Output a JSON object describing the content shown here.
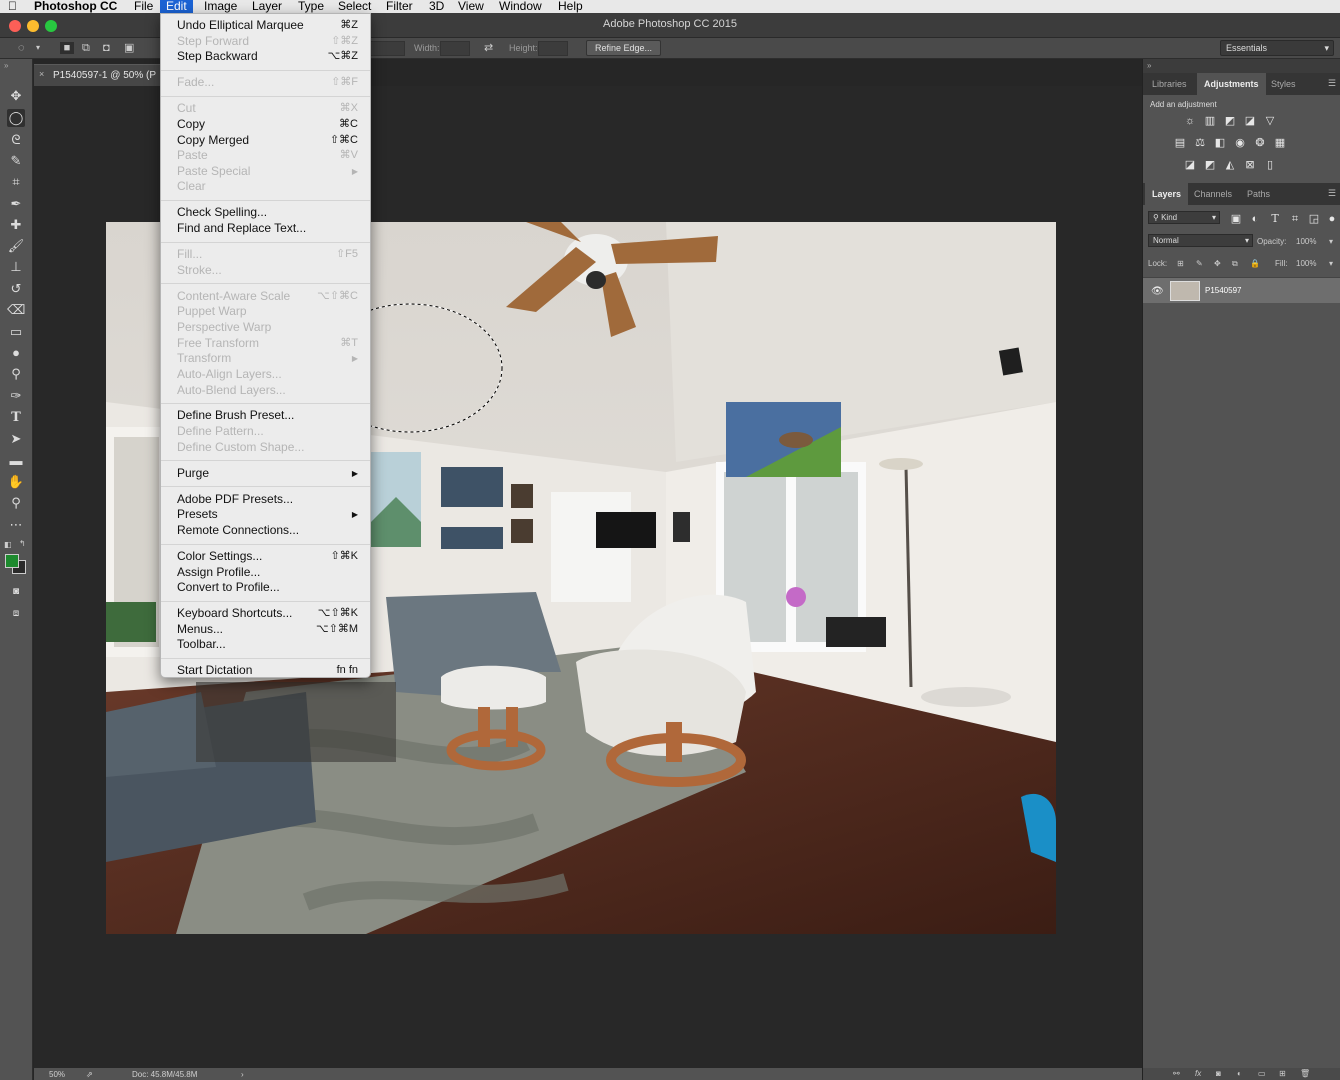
{
  "menubar": {
    "app_name": "Photoshop CC",
    "items": [
      "File",
      "Edit",
      "Image",
      "Layer",
      "Type",
      "Select",
      "Filter",
      "3D",
      "View",
      "Window",
      "Help"
    ],
    "active_item": "Edit"
  },
  "window": {
    "title": "Adobe Photoshop CC 2015"
  },
  "options": {
    "width_label": "Width:",
    "height_label": "Height:",
    "refine_edge": "Refine Edge...",
    "workspace": "Essentials"
  },
  "document": {
    "tab_title": "P1540597-1 @ 50% (P"
  },
  "edit_menu": [
    {
      "label": "Undo Elliptical Marquee",
      "shortcut": "⌘Z",
      "enabled": true
    },
    {
      "label": "Step Forward",
      "shortcut": "⇧⌘Z",
      "enabled": false
    },
    {
      "label": "Step Backward",
      "shortcut": "⌥⌘Z",
      "enabled": true
    },
    {
      "sep": true
    },
    {
      "label": "Fade...",
      "shortcut": "⇧⌘F",
      "enabled": false
    },
    {
      "sep": true
    },
    {
      "label": "Cut",
      "shortcut": "⌘X",
      "enabled": false
    },
    {
      "label": "Copy",
      "shortcut": "⌘C",
      "enabled": true
    },
    {
      "label": "Copy Merged",
      "shortcut": "⇧⌘C",
      "enabled": true
    },
    {
      "label": "Paste",
      "shortcut": "⌘V",
      "enabled": false
    },
    {
      "label": "Paste Special",
      "shortcut": "▶",
      "enabled": false
    },
    {
      "label": "Clear",
      "shortcut": "",
      "enabled": false
    },
    {
      "sep": true
    },
    {
      "label": "Check Spelling...",
      "shortcut": "",
      "enabled": true
    },
    {
      "label": "Find and Replace Text...",
      "shortcut": "",
      "enabled": true
    },
    {
      "sep": true
    },
    {
      "label": "Fill...",
      "shortcut": "⇧F5",
      "enabled": false
    },
    {
      "label": "Stroke...",
      "shortcut": "",
      "enabled": false
    },
    {
      "sep": true
    },
    {
      "label": "Content-Aware Scale",
      "shortcut": "⌥⇧⌘C",
      "enabled": false
    },
    {
      "label": "Puppet Warp",
      "shortcut": "",
      "enabled": false
    },
    {
      "label": "Perspective Warp",
      "shortcut": "",
      "enabled": false
    },
    {
      "label": "Free Transform",
      "shortcut": "⌘T",
      "enabled": false
    },
    {
      "label": "Transform",
      "shortcut": "▶",
      "enabled": false
    },
    {
      "label": "Auto-Align Layers...",
      "shortcut": "",
      "enabled": false
    },
    {
      "label": "Auto-Blend Layers...",
      "shortcut": "",
      "enabled": false
    },
    {
      "sep": true
    },
    {
      "label": "Define Brush Preset...",
      "shortcut": "",
      "enabled": true
    },
    {
      "label": "Define Pattern...",
      "shortcut": "",
      "enabled": false
    },
    {
      "label": "Define Custom Shape...",
      "shortcut": "",
      "enabled": false
    },
    {
      "sep": true
    },
    {
      "label": "Purge",
      "shortcut": "▶",
      "enabled": true
    },
    {
      "sep": true
    },
    {
      "label": "Adobe PDF Presets...",
      "shortcut": "",
      "enabled": true
    },
    {
      "label": "Presets",
      "shortcut": "▶",
      "enabled": true
    },
    {
      "label": "Remote Connections...",
      "shortcut": "",
      "enabled": true
    },
    {
      "sep": true
    },
    {
      "label": "Color Settings...",
      "shortcut": "⇧⌘K",
      "enabled": true
    },
    {
      "label": "Assign Profile...",
      "shortcut": "",
      "enabled": true
    },
    {
      "label": "Convert to Profile...",
      "shortcut": "",
      "enabled": true
    },
    {
      "sep": true
    },
    {
      "label": "Keyboard Shortcuts...",
      "shortcut": "⌥⇧⌘K",
      "enabled": true
    },
    {
      "label": "Menus...",
      "shortcut": "⌥⇧⌘M",
      "enabled": true
    },
    {
      "label": "Toolbar...",
      "shortcut": "",
      "enabled": true
    },
    {
      "sep": true
    },
    {
      "label": "Start Dictation",
      "shortcut": "fn fn",
      "enabled": true
    }
  ],
  "right_panel": {
    "top_tabs": [
      "Libraries",
      "Adjustments",
      "Styles"
    ],
    "active_top_tab": "Adjustments",
    "add_adjustment": "Add an adjustment",
    "layer_tabs": [
      "Layers",
      "Channels",
      "Paths"
    ],
    "active_layer_tab": "Layers",
    "kind_filter": "Kind",
    "blend_mode": "Normal",
    "opacity_label": "Opacity:",
    "opacity_value": "100%",
    "lock_label": "Lock:",
    "fill_label": "Fill:",
    "fill_value": "100%",
    "layer_name": "P1540597"
  },
  "status": {
    "zoom": "50%",
    "doc_size": "Doc: 45.8M/45.8M"
  }
}
